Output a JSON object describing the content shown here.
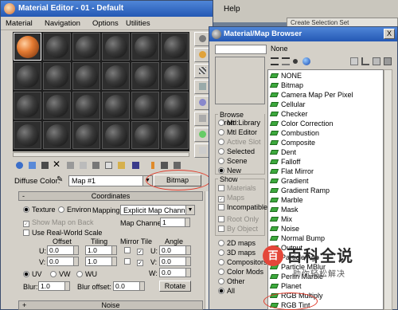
{
  "background": {
    "help_menu": "Help",
    "selection_set_placeholder": "Create Selection Set"
  },
  "material_editor": {
    "title": "Material Editor - 01 - Default",
    "menu": [
      "Material",
      "Navigation",
      "Options",
      "Utilities"
    ],
    "slots": {
      "rows": 4,
      "cols": 6,
      "selected_index": 0
    },
    "diffuse_label": "Diffuse Color:",
    "map_name": "Map #1",
    "map_type_button": "Bitmap",
    "coordinates": {
      "rollout_title": "Coordinates",
      "rollout_toggle": "-",
      "texture_label": "Texture",
      "environ_label": "Environ",
      "mapping_label": "Mapping:",
      "mapping_value": "Explicit Map Channel",
      "show_map_on_back": "Show Map on Back",
      "map_channel_label": "Map Channel:",
      "map_channel_value": "1",
      "real_world_scale": "Use Real-World Scale",
      "col_offset": "Offset",
      "col_tiling": "Tiling",
      "col_mirror_tile": "Mirror Tile",
      "col_angle": "Angle",
      "u_label": "U:",
      "v_label": "V:",
      "w_label": "W:",
      "u_offset": "0.0",
      "v_offset": "0.0",
      "u_tiling": "1.0",
      "v_tiling": "1.0",
      "u_angle": "0.0",
      "v_angle": "0.0",
      "w_angle": "0.0",
      "uv_label": "UV",
      "vw_label": "VW",
      "wu_label": "WU",
      "blur_label": "Blur:",
      "blur_value": "1.0",
      "blur_offset_label": "Blur offset:",
      "blur_offset_value": "0.0",
      "rotate_button": "Rotate"
    },
    "noise": {
      "rollout_title": "Noise",
      "rollout_toggle": "+"
    }
  },
  "browser": {
    "title": "Material/Map Browser",
    "close": "X",
    "current": "None",
    "browse_from": {
      "title": "Browse From:",
      "options": [
        "Mtl Library",
        "Mtl Editor",
        "Active Slot",
        "Selected",
        "Scene",
        "New"
      ],
      "selected_index": 5
    },
    "show": {
      "title": "Show",
      "options": [
        "Materials",
        "Maps",
        "Incompatible"
      ],
      "sub": [
        "Root Only",
        "By Object"
      ]
    },
    "categories": [
      "2D maps",
      "3D maps",
      "Compositors",
      "Color Mods",
      "Other",
      "All"
    ],
    "categories_selected": 5,
    "items": [
      "NONE",
      "Bitmap",
      "Camera Map Per Pixel",
      "Cellular",
      "Checker",
      "Color Correction",
      "Combustion",
      "Composite",
      "Dent",
      "Falloff",
      "Flat Mirror",
      "Gradient",
      "Gradient Ramp",
      "Marble",
      "Mask",
      "Mix",
      "Noise",
      "Normal Bump",
      "Output",
      "Particle Age",
      "Particle MBlur",
      "Perlin Marble",
      "Planet",
      "RGB Multiply",
      "RGB Tint"
    ]
  },
  "watermark": {
    "main": "百科全说",
    "sub": "助你轻松解决"
  }
}
